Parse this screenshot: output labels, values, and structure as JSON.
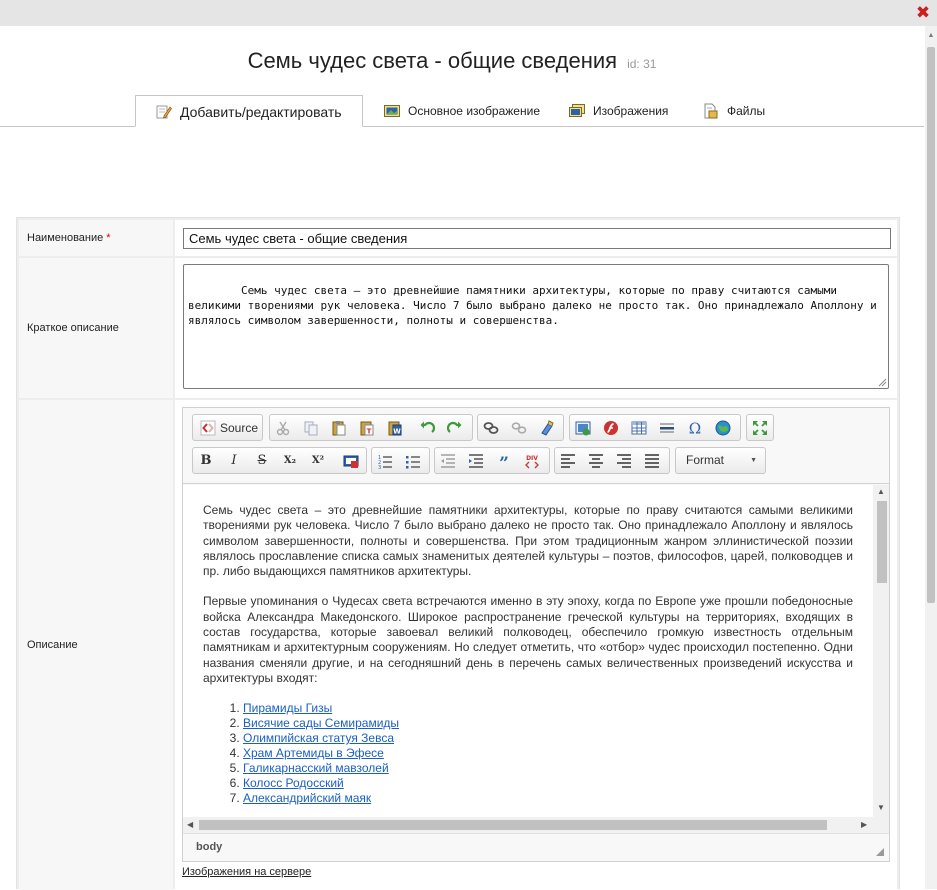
{
  "window": {
    "close_icon": "close-icon",
    "close_color": "#cc1f1f"
  },
  "header": {
    "title": "Семь чудес света - общие сведения",
    "id_label": "id: 31"
  },
  "tabs": [
    {
      "label": "Добавить/редактировать",
      "icon": "pencil-note-icon",
      "active": true
    },
    {
      "label": "Основное изображение",
      "icon": "picture-icon",
      "active": false
    },
    {
      "label": "Изображения",
      "icon": "pictures-icon",
      "active": false
    },
    {
      "label": "Файлы",
      "icon": "files-icon",
      "active": false
    }
  ],
  "form": {
    "name": {
      "label": "Наименование",
      "required_mark": "*",
      "value": "Семь чудес света - общие сведения"
    },
    "short_description": {
      "label": "Краткое описание",
      "value": "Семь чудес света – это древнейшие памятники архитектуры, которые по праву считаются самыми великими творениями рук человека. Число 7 было выбрано далеко не просто так. Оно принадлежало Аполлону и являлось символом завершенности, полноты и совершенства."
    },
    "description": {
      "label": "Описание",
      "toolbar": {
        "source_label": "Source",
        "format_label": "Format",
        "row1_icons": [
          "source-icon",
          "cut-icon",
          "copy-icon",
          "paste-icon",
          "paste-text-icon",
          "paste-word-icon",
          "undo-icon",
          "redo-icon",
          "link-icon",
          "unlink-icon",
          "anchor-icon",
          "image-icon",
          "flash-icon",
          "table-icon",
          "horizontal-rule-icon",
          "special-char-icon",
          "iframe-icon",
          "maximize-icon"
        ],
        "row2_icons": [
          "bold-icon",
          "italic-icon",
          "strike-icon",
          "subscript-icon",
          "superscript-icon",
          "remove-format-icon",
          "numbered-list-icon",
          "bulleted-list-icon",
          "outdent-icon",
          "indent-icon",
          "blockquote-icon",
          "create-div-icon",
          "align-left-icon",
          "align-center-icon",
          "align-right-icon",
          "justify-icon"
        ],
        "row2_text": {
          "bold": "B",
          "italic": "I",
          "strike": "S",
          "sub": "X₂",
          "sup": "X²"
        }
      },
      "paragraphs": [
        "Семь чудес света – это древнейшие памятники архитектуры, которые по праву считаются самыми великими творениями рук человека. Число 7 было выбрано далеко не просто так. Оно принадлежало Аполлону и являлось символом завершенности, полноты и совершенства. При этом традиционным жанром эллинистической поэзии являлось прославление списка самых знаменитых деятелей культуры – поэтов, философов, царей, полководцев и пр. либо выдающихся памятников архитектуры.",
        "Первые упоминания о Чудесах света встречаются именно в эту эпоху, когда по Европе уже прошли победоносные войска Александра Македонского. Широкое распространение греческой культуры на территориях, входящих в состав государства, которые завоевал великий полководец, обеспечило громкую известность отдельным памятникам и архитектурным сооружениям. Но следует отметить, что «отбор» чудес происходил постепенно. Одни названия сменяли другие, и на сегодняшний день в перечень самых величественных произведений искусства и архитектуры входят:"
      ],
      "list": [
        "Пирамиды Гизы",
        "Висячие сады Семирамиды",
        "Олимпийская статуя Зевса",
        "Храм Артемиды в Эфесе",
        "Галикарнасский мавзолей",
        "Колосс Родосский",
        "Александрийский маяк"
      ],
      "status_path": "body",
      "server_images_link": "Изображения на сервере"
    }
  }
}
